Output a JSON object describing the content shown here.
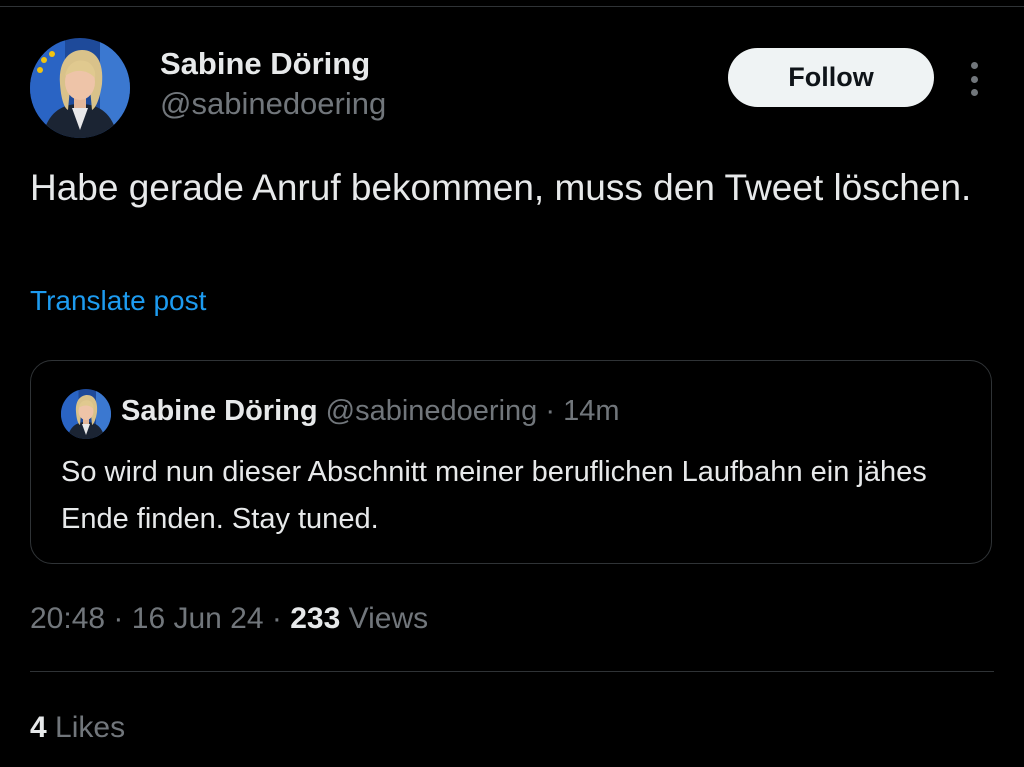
{
  "author": {
    "name": "Sabine Döring",
    "handle": "@sabinedoering"
  },
  "actions": {
    "follow_label": "Follow",
    "more_icon": "more-vertical-icon"
  },
  "tweet": {
    "text": "Habe gerade Anruf bekommen, muss den Tweet löschen.",
    "translate_label": "Translate post"
  },
  "quoted_tweet": {
    "name": "Sabine Döring",
    "handle": "@sabinedoering",
    "separator": "·",
    "time": "14m",
    "text": "So wird nun dieser Abschnitt meiner beruflichen Laufbahn ein jähes Ende finden. Stay tuned."
  },
  "meta": {
    "time": "20:48",
    "separator": "·",
    "date": "16 Jun 24",
    "views_count": "233",
    "views_label": "Views"
  },
  "engagement": {
    "likes_count": "4",
    "likes_label": "Likes"
  },
  "colors": {
    "background": "#000000",
    "text_primary": "#e7e9ea",
    "text_secondary": "#71767b",
    "link": "#1d9bf0",
    "border": "#2f3336",
    "follow_button_bg": "#eff3f4"
  }
}
